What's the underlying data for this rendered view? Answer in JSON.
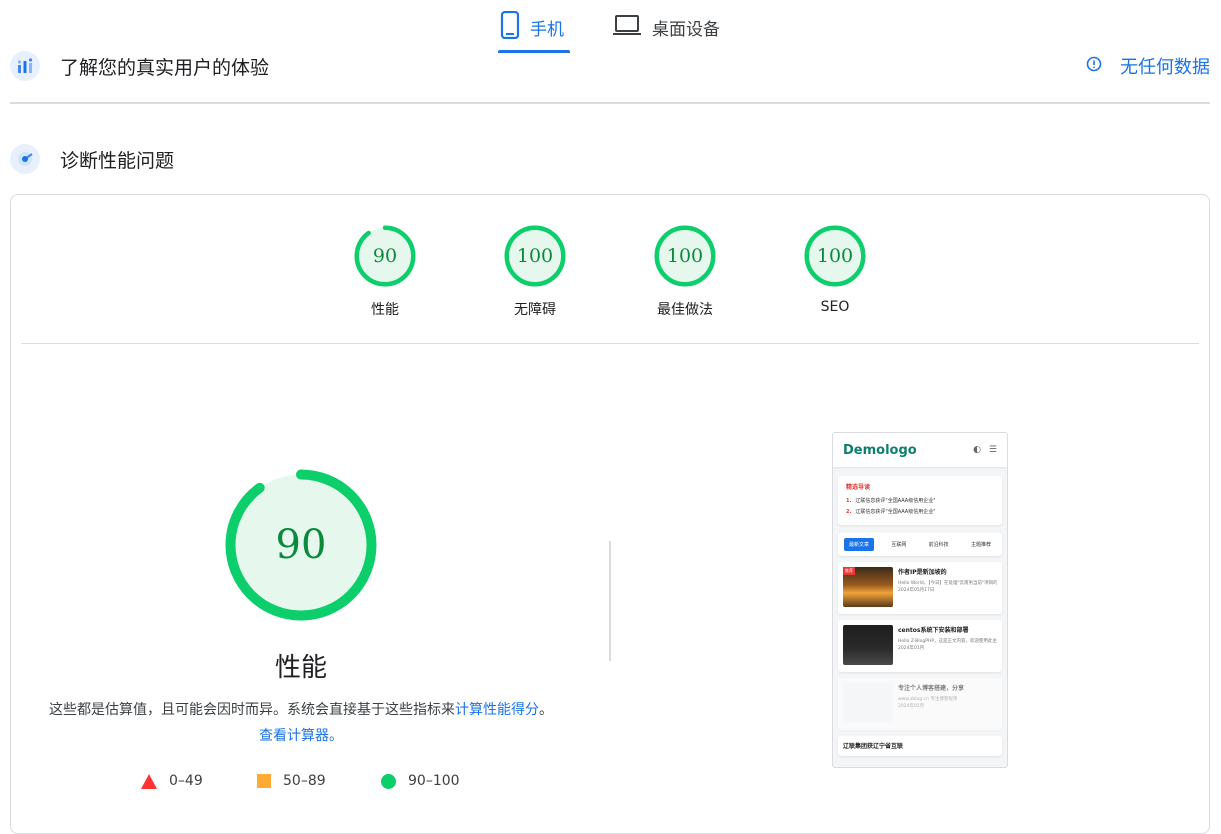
{
  "tabs": {
    "mobile_label": "手机",
    "desktop_label": "桌面设备"
  },
  "crux": {
    "title": "了解您的真实用户的体验",
    "nodata_label": "无任何数据"
  },
  "diagnostics": {
    "title": "诊断性能问题"
  },
  "scores": [
    {
      "value": "90",
      "label": "性能",
      "fraction": 0.9
    },
    {
      "value": "100",
      "label": "无障碍",
      "fraction": 1.0
    },
    {
      "value": "100",
      "label": "最佳做法",
      "fraction": 1.0
    },
    {
      "value": "100",
      "label": "SEO",
      "fraction": 1.0
    }
  ],
  "performance": {
    "score": "90",
    "fraction": 0.9,
    "title": "性能",
    "explain_text": "这些都是估算值，且可能会因时而异。系统会直接基于这些指标来",
    "calc_link": "计算性能得分",
    "sep": "。",
    "calculator_link": "查看计算器。"
  },
  "legend": [
    {
      "range": "0–49",
      "color": "#ff3333"
    },
    {
      "range": "50–89",
      "color": "#ffaa33"
    },
    {
      "range": "90–100",
      "color": "#0cce6b"
    }
  ],
  "colors": {
    "accent": "#1a73e8",
    "pass": "#0cce6b",
    "pass_text": "#0c8a3c",
    "pass_bg": "#e6f8ee"
  },
  "phone": {
    "logo": "Demologo",
    "box_title": "精选导读",
    "box_items": [
      "辽联信息获评\"全国AAA级信用企业\"",
      "辽联信息获评\"全国AAA级信用企业\""
    ],
    "tabs": [
      "最新文章",
      "互联网",
      "前沿科技",
      "主题推荐"
    ],
    "articles": [
      {
        "badge": "推荐",
        "title": "作者IP是新加坡的",
        "desc": "Hello World，【今日】在处理\"云南男当前\"项目的时候",
        "date": "2024年05月17日"
      },
      {
        "title": "centos系统下安装和部署",
        "desc": "Hello Z-BlogPHP，这是正文内容，欢迎使用此主题来写自己的",
        "date": "2024年01月"
      },
      {
        "title": "专注个人博客搭建，分享",
        "desc": "www.zblog.cn 专注博客程序",
        "date": "2024年01月"
      },
      {
        "title": "辽联集团获辽宁省互联",
        "desc": "",
        "date": ""
      }
    ]
  }
}
